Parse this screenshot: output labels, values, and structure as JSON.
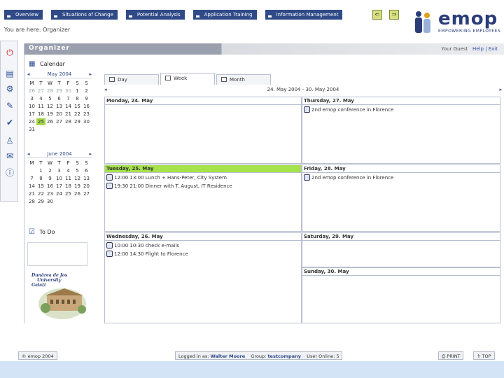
{
  "nav": {
    "tabs": [
      "Overview",
      "Situations of Change",
      "Potential Analysis",
      "Application Training",
      "Information Management"
    ]
  },
  "breadcrumb": "You are here: Organizer",
  "logo": {
    "word": "emop",
    "tagline": "EMPOWERING EMPLOYEES"
  },
  "panel": {
    "title": "Organizer",
    "link_account": "Your Guest",
    "link_help": "Help | Exit"
  },
  "calendar": {
    "heading": "Calendar",
    "month1": {
      "name": "May 2004",
      "weekdays": [
        "M",
        "T",
        "W",
        "T",
        "F",
        "S",
        "S"
      ],
      "days": [
        "26",
        "27",
        "28",
        "29",
        "30",
        "1",
        "2",
        "3",
        "4",
        "5",
        "6",
        "7",
        "8",
        "9",
        "10",
        "11",
        "12",
        "13",
        "14",
        "15",
        "16",
        "17",
        "18",
        "19",
        "20",
        "21",
        "22",
        "23",
        "24",
        "25",
        "26",
        "27",
        "28",
        "29",
        "30",
        "31"
      ],
      "dim_count": 5,
      "selected": "25"
    },
    "month2": {
      "name": "June 2004",
      "weekdays": [
        "M",
        "T",
        "W",
        "T",
        "F",
        "S",
        "S"
      ],
      "days": [
        "",
        "1",
        "2",
        "3",
        "4",
        "5",
        "6",
        "7",
        "8",
        "9",
        "10",
        "11",
        "12",
        "13",
        "14",
        "15",
        "16",
        "17",
        "18",
        "19",
        "20",
        "21",
        "22",
        "23",
        "24",
        "25",
        "26",
        "27",
        "28",
        "29",
        "30"
      ]
    }
  },
  "todo": {
    "heading": "To Do"
  },
  "uni": {
    "line1": "Dunărea de Jos",
    "line2": "University",
    "line3": "Galați"
  },
  "view_tabs": {
    "day": "Day",
    "week": "Week",
    "month": "Month"
  },
  "week_range": "24. May 2004 - 30. May 2004",
  "days": {
    "mon": {
      "label": "Monday, 24. May",
      "events": []
    },
    "tue": {
      "label": "Tuesday, 25. May",
      "events": [
        {
          "text": "12:00 13:00 Lunch + Hans-Peter, City System"
        },
        {
          "text": "19:30 21:00 Dinner with T. August, IT Residence"
        }
      ]
    },
    "wed": {
      "label": "Wednesday, 26. May",
      "events": [
        {
          "text": "10:00 10:30 check e-mails"
        },
        {
          "text": "12:00 14:30 Flight to Florence"
        }
      ]
    },
    "thu": {
      "label": "Thursday, 27. May",
      "events": [
        {
          "text": "2nd emop conference in Florence"
        }
      ]
    },
    "fri": {
      "label": "Friday, 28. May",
      "events": [
        {
          "text": "2nd emop conference in Florence"
        }
      ]
    },
    "sat": {
      "label": "Saturday, 29. May",
      "events": []
    },
    "sun": {
      "label": "Sunday, 30. May",
      "events": []
    }
  },
  "footer": {
    "copyright": "© emop 2004",
    "logged_label": "Logged in as:",
    "logged_user": "Walter Moore",
    "group_label": "Group:",
    "group_value": "testcompany",
    "users_online": "User Online: 5",
    "print": "PRINT",
    "top": "TOP"
  },
  "colors": {
    "nav": "#2f4a87",
    "today": "#a6e24a",
    "selected_day": "#a6d948",
    "bottom_bar": "#d2e4f6"
  }
}
